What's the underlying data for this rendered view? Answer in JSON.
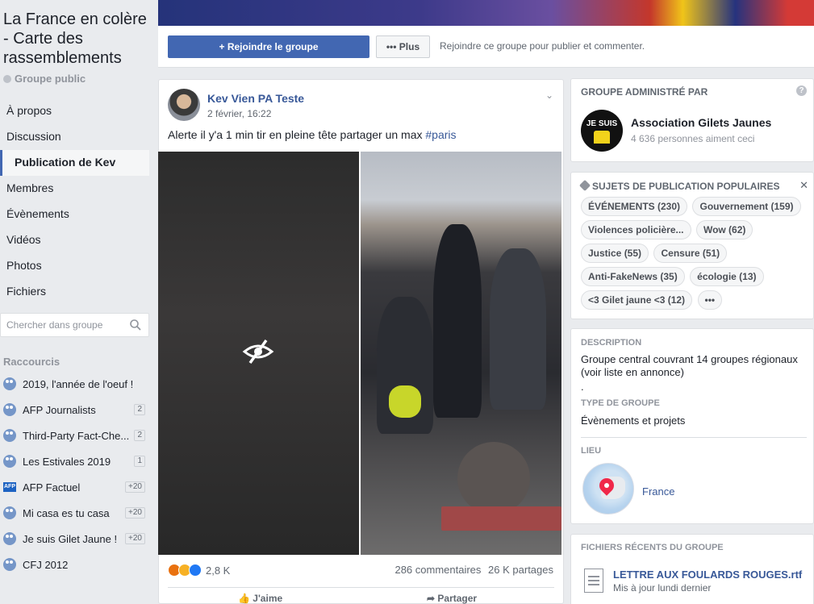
{
  "group": {
    "title": "La France en colère - Carte des rassemblements",
    "privacy": "Groupe public"
  },
  "nav": {
    "items": [
      {
        "label": "À propos",
        "active": false
      },
      {
        "label": "Discussion",
        "active": false
      },
      {
        "label": "Publication de Kev",
        "active": true
      },
      {
        "label": "Membres",
        "active": false
      },
      {
        "label": "Évènements",
        "active": false
      },
      {
        "label": "Vidéos",
        "active": false
      },
      {
        "label": "Photos",
        "active": false
      },
      {
        "label": "Fichiers",
        "active": false
      }
    ]
  },
  "search": {
    "placeholder": "Chercher dans groupe"
  },
  "shortcuts": {
    "title": "Raccourcis",
    "items": [
      {
        "label": "2019, l'année de l'oeuf !",
        "badge": "",
        "icon": "group-icon"
      },
      {
        "label": "AFP Journalists",
        "badge": "2",
        "icon": "group-icon"
      },
      {
        "label": "Third-Party Fact-Che...",
        "badge": "2",
        "icon": "group-icon"
      },
      {
        "label": "Les Estivales 2019",
        "badge": "1",
        "icon": "group-icon"
      },
      {
        "label": "AFP Factuel",
        "badge": "+20",
        "icon": "afp-logo-icon"
      },
      {
        "label": "Mi casa es tu casa",
        "badge": "+20",
        "icon": "group-icon"
      },
      {
        "label": "Je suis Gilet Jaune !",
        "badge": "+20",
        "icon": "group-icon"
      },
      {
        "label": "CFJ 2012",
        "badge": "",
        "icon": "group-icon"
      }
    ]
  },
  "actions": {
    "join_label": "Rejoindre le groupe",
    "more_label": "Plus",
    "hint": "Rejoindre ce groupe pour publier et commenter."
  },
  "post": {
    "author": "Kev Vien PA Teste",
    "time": "2 février, 16:22",
    "text": "Alerte il y'a 1 min tir en pleine tête partager un max ",
    "hashtag": "#paris",
    "reaction_count": "2,8 K",
    "comments": "286 commentaires",
    "shares": "26 K partages",
    "like_label": "J'aime",
    "share_label": "Partager"
  },
  "admin": {
    "heading": "GROUPE ADMINISTRÉ PAR",
    "avatar_text": "JE SUIS",
    "name": "Association Gilets Jaunes",
    "likes": "4 636 personnes aiment ceci"
  },
  "topics": {
    "heading": "SUJETS DE PUBLICATION POPULAIRES",
    "chips": [
      "ÉVÉNEMENTS (230)",
      "Gouvernement (159)",
      "Violences policière...",
      "Wow (62)",
      "Justice (55)",
      "Censure (51)",
      "Anti-FakeNews (35)",
      "écologie (13)",
      "<3 Gilet jaune <3 (12)",
      "•••"
    ]
  },
  "about": {
    "description_label": "DESCRIPTION",
    "description": "Groupe central couvrant 14 groupes régionaux (voir liste en annonce)",
    "description_dot": ".",
    "type_label": "TYPE DE GROUPE",
    "type": "Évènements et projets",
    "location_label": "LIEU",
    "location": "France"
  },
  "files": {
    "heading": "FICHIERS RÉCENTS DU GROUPE",
    "name": "LETTRE AUX FOULARDS ROUGES.rtf",
    "meta": "Mis à jour lundi dernier"
  },
  "colors": {
    "facebook_blue": "#4267b2",
    "link_blue": "#385898",
    "background": "#e9ebee"
  }
}
